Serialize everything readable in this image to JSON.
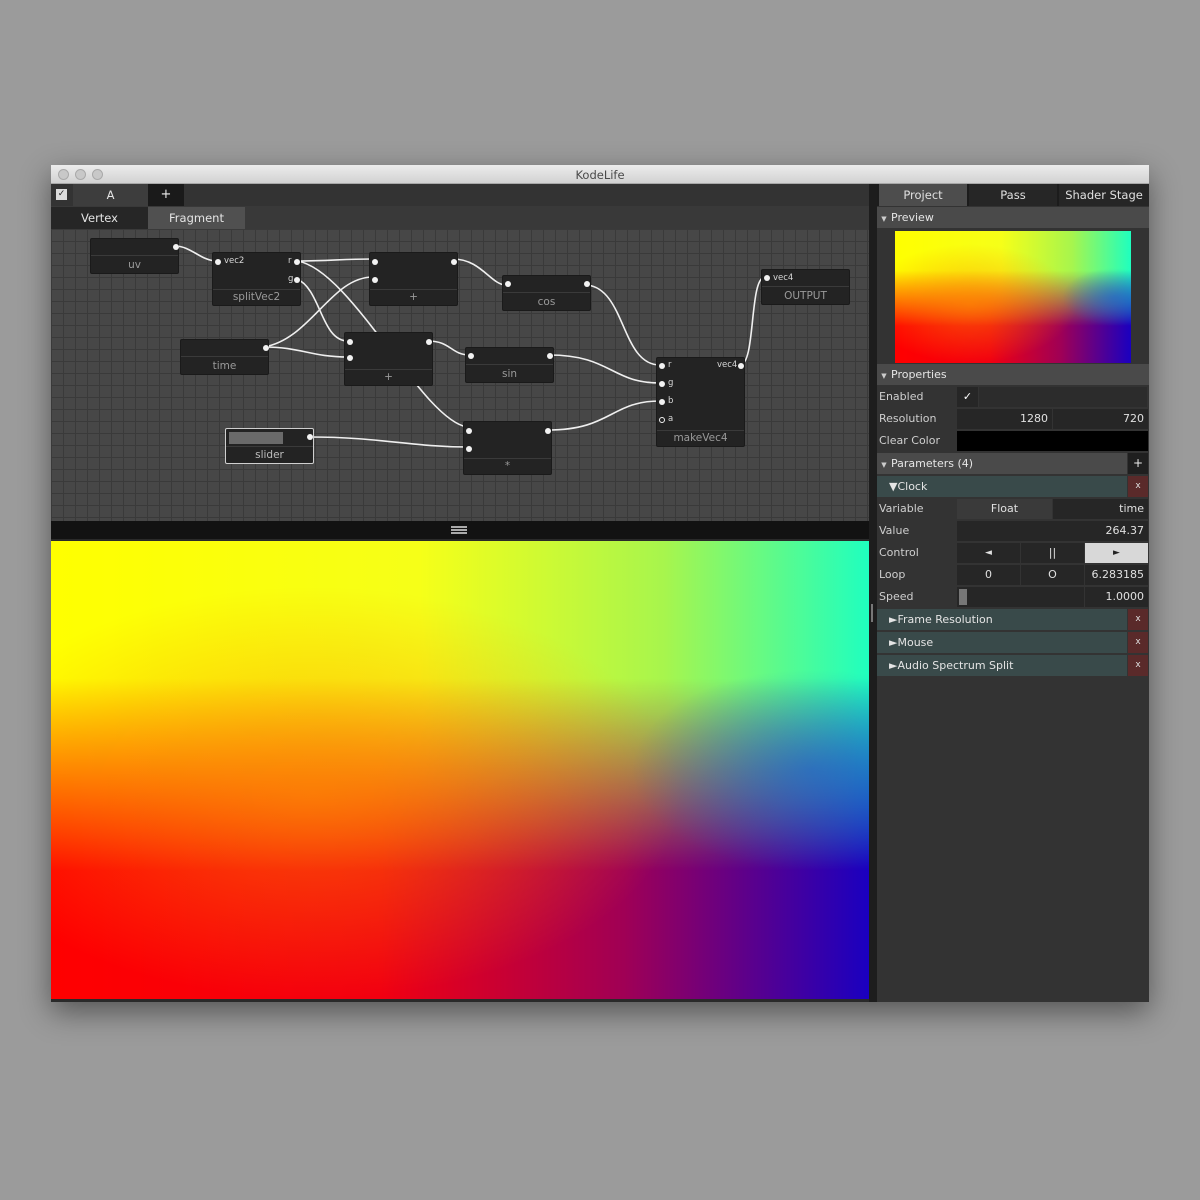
{
  "window": {
    "title": "KodeLife"
  },
  "left": {
    "pass_enabled_check": "✓",
    "pass_tab": "A",
    "add_pass": "+",
    "tabs": [
      "Vertex",
      "Fragment"
    ]
  },
  "graph": {
    "nodes": {
      "uv": "uv",
      "splitVec2": {
        "label": "splitVec2",
        "in": "vec2",
        "out_r": "r",
        "out_g": "g"
      },
      "add": "+",
      "cos": "cos",
      "time": "time",
      "add2": "+",
      "sin": "sin",
      "makeVec4": {
        "label": "makeVec4",
        "in_r": "r",
        "in_g": "g",
        "in_b": "b",
        "in_a": "a",
        "out": "vec4"
      },
      "output": {
        "label": "OUTPUT",
        "in": "vec4"
      },
      "slider": "slider",
      "mul": "*"
    }
  },
  "right": {
    "tabs": [
      "Project",
      "Pass",
      "Shader Stage"
    ],
    "preview_header": "Preview",
    "properties_header": "Properties",
    "enabled_label": "Enabled",
    "enabled_value": "✓",
    "resolution_label": "Resolution",
    "resolution_w": "1280",
    "resolution_h": "720",
    "clear_color_label": "Clear Color",
    "clear_color": "#000000",
    "parameters_header": "Parameters (4)",
    "add_param": "+",
    "clock": {
      "title": "Clock",
      "remove": "x",
      "variable_label": "Variable",
      "variable_type": "Float",
      "variable_name": "time",
      "value_label": "Value",
      "value": "264.37",
      "control_label": "Control",
      "control_rewind": "◄",
      "control_pause": "||",
      "control_play": "►",
      "loop_label": "Loop",
      "loop_start": "0",
      "loop_mode": "O",
      "loop_end": "6.283185",
      "speed_label": "Speed",
      "speed": "1.0000"
    },
    "params": [
      {
        "title": "Frame Resolution",
        "remove": "x"
      },
      {
        "title": "Mouse",
        "remove": "x"
      },
      {
        "title": "Audio Spectrum Split",
        "remove": "x"
      }
    ]
  }
}
